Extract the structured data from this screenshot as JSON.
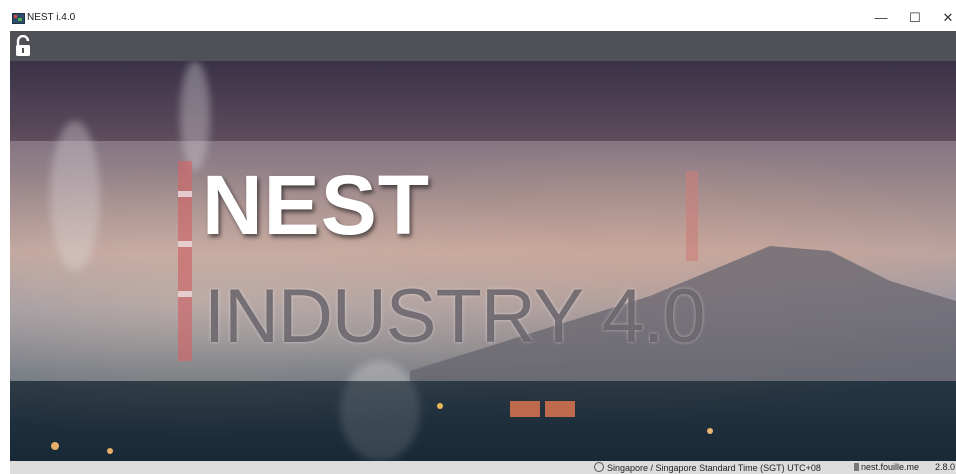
{
  "window": {
    "title": "NEST i.4.0",
    "minimize": "—",
    "maximize": "☐",
    "close": "✕"
  },
  "toolbar": {
    "lock_icon": "unlocked-padlock-icon"
  },
  "hero": {
    "title": "NEST",
    "subtitle": "INDUSTRY 4.0"
  },
  "status": {
    "timezone": "Singapore / Singapore Standard Time (SGT) UTC+08",
    "server": "nest.fouille.me",
    "version": "2.8.0"
  }
}
